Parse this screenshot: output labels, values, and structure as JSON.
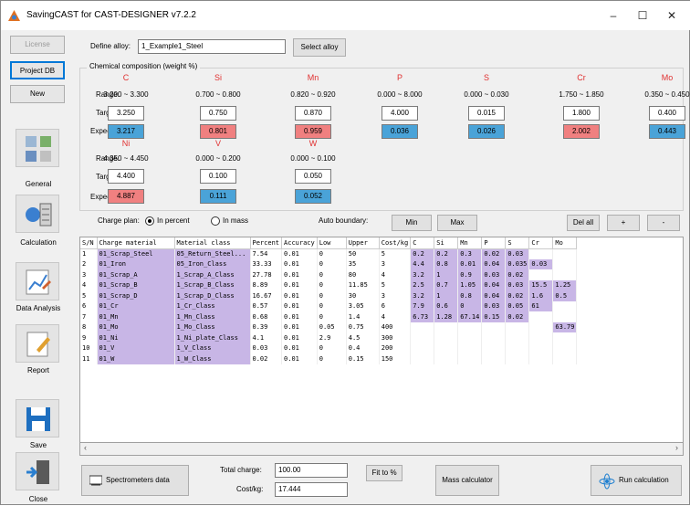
{
  "window": {
    "title": "SavingCAST for CAST-DESIGNER v7.2.2"
  },
  "sidebar": {
    "license": "License",
    "project_db": "Project DB",
    "new": "New",
    "general": "General",
    "calculation": "Calculation",
    "data_analysis": "Data Analysis",
    "report": "Report",
    "save": "Save",
    "close": "Close"
  },
  "alloy": {
    "label": "Define alloy:",
    "value": "1_Example1_Steel",
    "select_btn": "Select alloy"
  },
  "composition": {
    "group_title": "Chemical composition (weight %)",
    "row_labels": {
      "range": "Range:",
      "target": "Target",
      "expected": "Expected"
    },
    "row1": [
      {
        "el": "C",
        "range": "3.200 ~ 3.300",
        "target": "3.250",
        "expected": "3.217",
        "status": "blue"
      },
      {
        "el": "Si",
        "range": "0.700 ~ 0.800",
        "target": "0.750",
        "expected": "0.801",
        "status": "red"
      },
      {
        "el": "Mn",
        "range": "0.820 ~ 0.920",
        "target": "0.870",
        "expected": "0.959",
        "status": "red"
      },
      {
        "el": "P",
        "range": "0.000 ~ 8.000",
        "target": "4.000",
        "expected": "0.036",
        "status": "blue"
      },
      {
        "el": "S",
        "range": "0.000 ~ 0.030",
        "target": "0.015",
        "expected": "0.026",
        "status": "blue"
      },
      {
        "el": "Cr",
        "range": "1.750 ~ 1.850",
        "target": "1.800",
        "expected": "2.002",
        "status": "red"
      },
      {
        "el": "Mo",
        "range": "0.350 ~ 0.450",
        "target": "0.400",
        "expected": "0.443",
        "status": "blue"
      }
    ],
    "row2": [
      {
        "el": "Ni",
        "range": "4.350 ~ 4.450",
        "target": "4.400",
        "expected": "4.887",
        "status": "red"
      },
      {
        "el": "V",
        "range": "0.000 ~ 0.200",
        "target": "0.100",
        "expected": "0.111",
        "status": "blue"
      },
      {
        "el": "W",
        "range": "0.000 ~ 0.100",
        "target": "0.050",
        "expected": "0.052",
        "status": "blue"
      }
    ]
  },
  "controls": {
    "charge_plan_label": "Charge plan:",
    "in_percent": "In percent",
    "in_mass": "In mass",
    "auto_boundary": "Auto boundary:",
    "min": "Min",
    "max": "Max",
    "del_all": "Del all",
    "plus": "+",
    "minus": "-"
  },
  "table": {
    "headers": [
      "S/N",
      "Charge material",
      "Material class",
      "Percent",
      "Accuracy",
      "Low",
      "Upper",
      "Cost/kg",
      "C",
      "Si",
      "Mn",
      "P",
      "S",
      "Cr",
      "Mo"
    ],
    "rows": [
      [
        "1",
        "01_Scrap_Steel",
        "05_Return_Steel...",
        "7.54",
        "0.01",
        "0",
        "50",
        "5",
        "0.2",
        "0.2",
        "0.3",
        "0.02",
        "0.03",
        "",
        ""
      ],
      [
        "2",
        "01_Iron",
        "05_Iron_Class",
        "33.33",
        "0.01",
        "0",
        "35",
        "3",
        "4.4",
        "0.8",
        "0.01",
        "0.04",
        "0.035",
        "0.03",
        ""
      ],
      [
        "3",
        "01_Scrap_A",
        "1_Scrap_A_Class",
        "27.78",
        "0.01",
        "0",
        "80",
        "4",
        "3.2",
        "1",
        "0.9",
        "0.03",
        "0.02",
        "",
        ""
      ],
      [
        "4",
        "01_Scrap_B",
        "1_Scrap_B_Class",
        "8.89",
        "0.01",
        "0",
        "11.85",
        "5",
        "2.5",
        "0.7",
        "1.05",
        "0.04",
        "0.03",
        "15.5",
        "1.25"
      ],
      [
        "5",
        "01_Scrap_D",
        "1_Scrap_D_Class",
        "16.67",
        "0.01",
        "0",
        "30",
        "3",
        "3.2",
        "1",
        "0.8",
        "0.04",
        "0.02",
        "1.6",
        "0.5"
      ],
      [
        "6",
        "01_Cr",
        "1_Cr_Class",
        "0.57",
        "0.01",
        "0",
        "3.05",
        "6",
        "7.9",
        "0.6",
        "0",
        "0.03",
        "0.05",
        "61",
        ""
      ],
      [
        "7",
        "01_Mn",
        "1_Mn_Class",
        "0.68",
        "0.01",
        "0",
        "1.4",
        "4",
        "6.73",
        "1.28",
        "67.14",
        "0.15",
        "0.02",
        "",
        ""
      ],
      [
        "8",
        "01_Mo",
        "1_Mo_Class",
        "0.39",
        "0.01",
        "0.05",
        "0.75",
        "400",
        "",
        "",
        "",
        "",
        "",
        "",
        "63.79"
      ],
      [
        "9",
        "01_Ni",
        "1_Ni_plate_Class",
        "4.1",
        "0.01",
        "2.9",
        "4.5",
        "300",
        "",
        "",
        "",
        "",
        "",
        "",
        ""
      ],
      [
        "10",
        "01_V",
        "1_V_Class",
        "0.03",
        "0.01",
        "0",
        "0.4",
        "200",
        "",
        "",
        "",
        "",
        "",
        "",
        ""
      ],
      [
        "11",
        "01_W",
        "1_W_Class",
        "0.02",
        "0.01",
        "0",
        "0.15",
        "150",
        "",
        "",
        "",
        "",
        "",
        "",
        ""
      ]
    ]
  },
  "bottom": {
    "spectrometer": "Spectrometers data",
    "total_charge_label": "Total charge:",
    "total_charge": "100.00",
    "cost_label": "Cost/kg:",
    "cost": "17.444",
    "fit_to": "Fit to %",
    "mass_calc": "Mass calculator",
    "run_calc": "Run calculation"
  },
  "colors": {
    "red": "#f08080",
    "blue": "#4aa3d8",
    "material": "#c8b6e6",
    "element": "#e03030"
  }
}
